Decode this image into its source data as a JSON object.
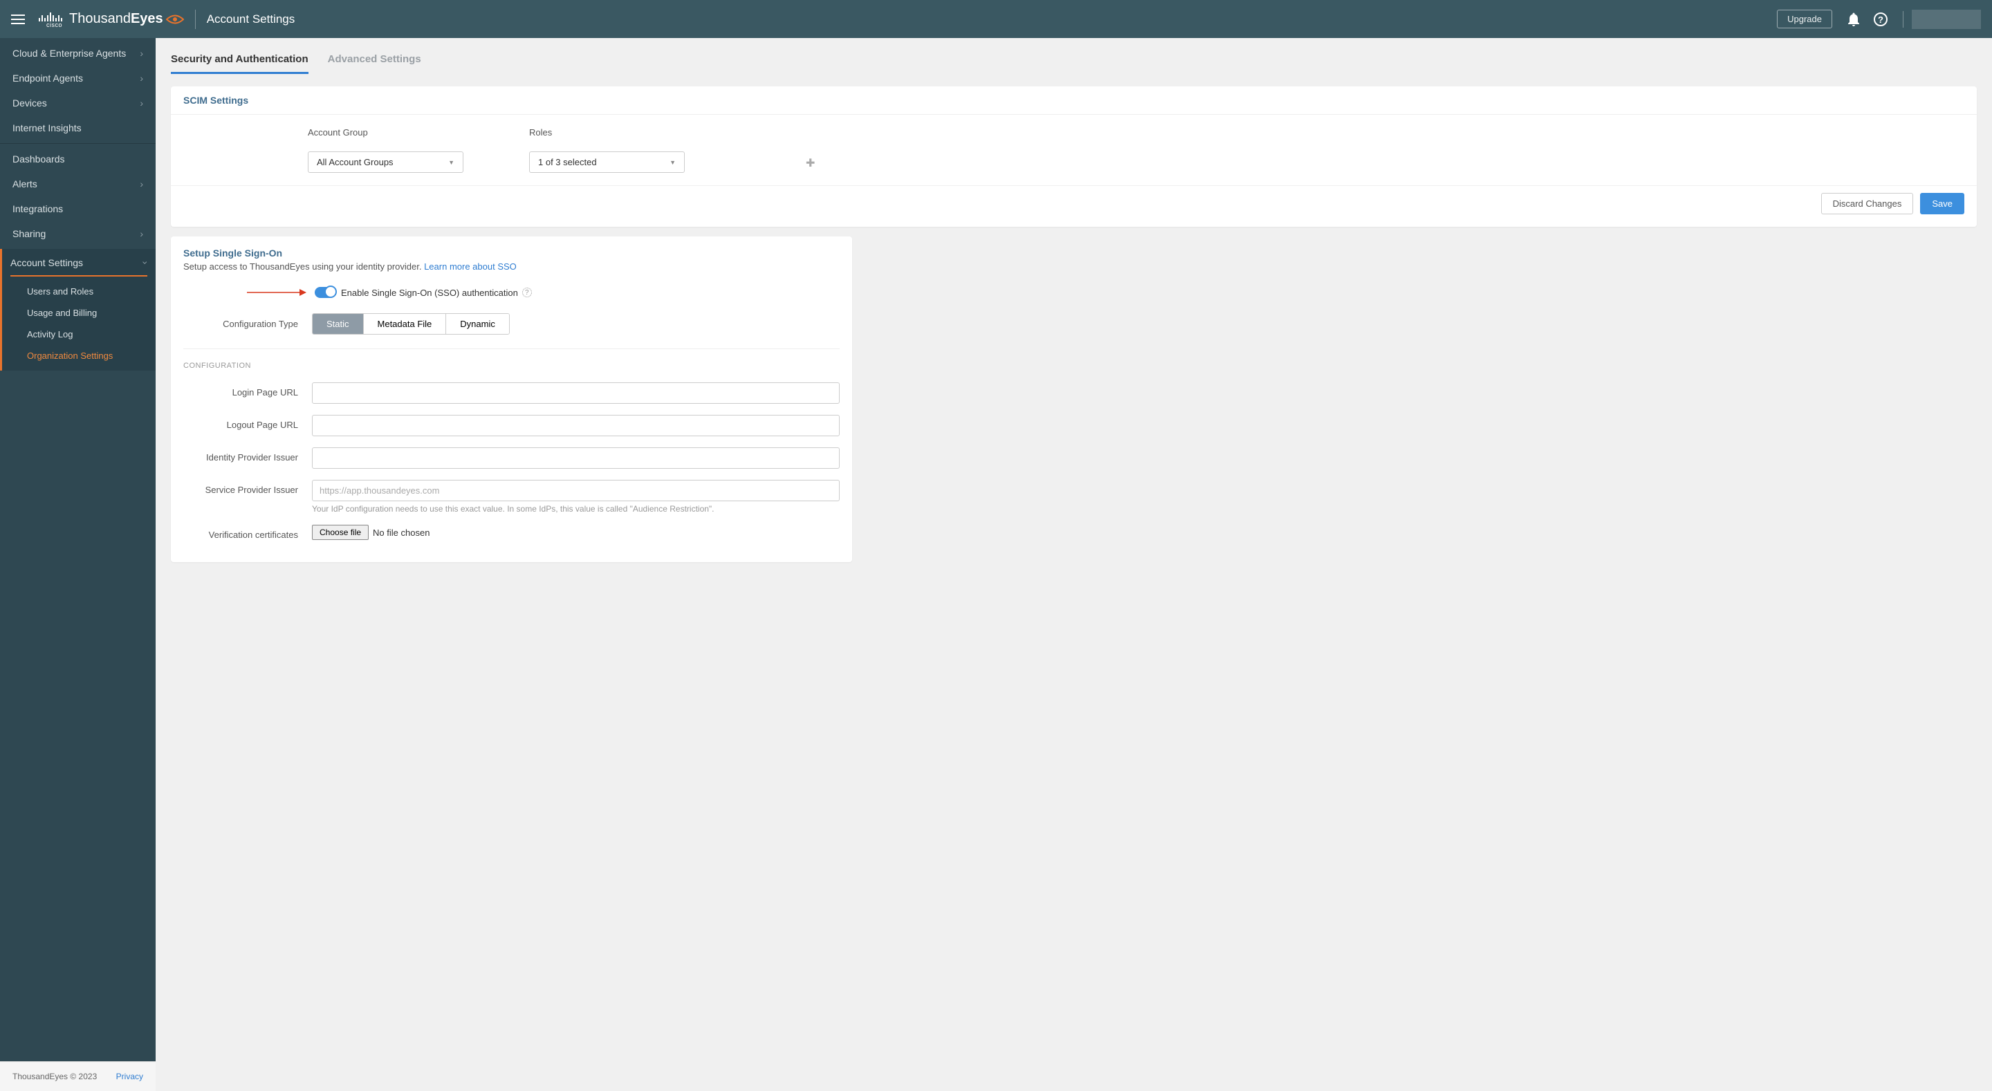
{
  "header": {
    "page_title": "Account Settings",
    "upgrade_label": "Upgrade",
    "brand_prefix": "Thousand",
    "brand_suffix": "Eyes",
    "cisco_label": "cisco"
  },
  "sidebar": {
    "group1": [
      {
        "label": "Cloud & Enterprise Agents",
        "chevron": true
      },
      {
        "label": "Endpoint Agents",
        "chevron": true
      },
      {
        "label": "Devices",
        "chevron": true
      },
      {
        "label": "Internet Insights",
        "chevron": false
      }
    ],
    "group2": [
      {
        "label": "Dashboards",
        "chevron": false
      },
      {
        "label": "Alerts",
        "chevron": true
      },
      {
        "label": "Integrations",
        "chevron": false
      },
      {
        "label": "Sharing",
        "chevron": true
      }
    ],
    "active_section": "Account Settings",
    "subitems": [
      {
        "label": "Users and Roles"
      },
      {
        "label": "Usage and Billing"
      },
      {
        "label": "Activity Log"
      },
      {
        "label": "Organization Settings"
      }
    ],
    "footer_copyright": "ThousandEyes © 2023",
    "footer_privacy": "Privacy"
  },
  "tabs": [
    {
      "label": "Security and Authentication",
      "active": true
    },
    {
      "label": "Advanced Settings",
      "active": false
    }
  ],
  "scim": {
    "title": "SCIM Settings",
    "account_group_label": "Account Group",
    "account_group_value": "All Account Groups",
    "roles_label": "Roles",
    "roles_value": "1 of 3 selected",
    "discard_label": "Discard Changes",
    "save_label": "Save"
  },
  "sso": {
    "title": "Setup Single Sign-On",
    "desc_prefix": "Setup access to ThousandEyes using your identity provider. ",
    "desc_link": "Learn more about SSO",
    "toggle_label": "Enable Single Sign-On (SSO) authentication",
    "config_type_label": "Configuration Type",
    "segments": [
      "Static",
      "Metadata File",
      "Dynamic"
    ],
    "section_label": "CONFIGURATION",
    "fields": {
      "login_url": "Login Page URL",
      "logout_url": "Logout Page URL",
      "idp_issuer": "Identity Provider Issuer",
      "sp_issuer": "Service Provider Issuer",
      "sp_issuer_placeholder": "https://app.thousandeyes.com",
      "sp_issuer_help": "Your IdP configuration needs to use this exact value. In some IdPs, this value is called \"Audience Restriction\".",
      "verification_cert": "Verification certificates",
      "choose_file": "Choose file",
      "no_file": "No file chosen"
    }
  }
}
